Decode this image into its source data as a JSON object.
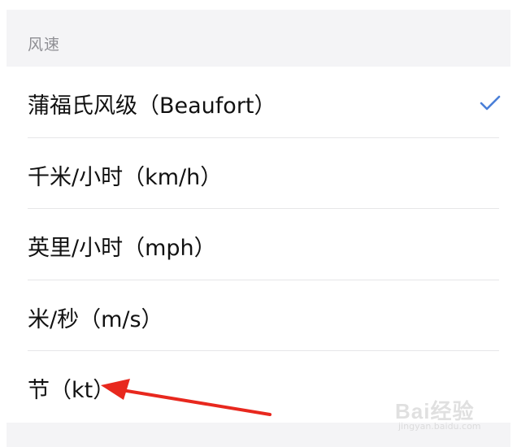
{
  "section": {
    "title": "风速"
  },
  "options": [
    {
      "label": "蒲福氏风级（Beaufort）",
      "selected": true
    },
    {
      "label": "千米/小时（km/h）",
      "selected": false
    },
    {
      "label": "英里/小时（mph）",
      "selected": false
    },
    {
      "label": "米/秒（m/s）",
      "selected": false
    },
    {
      "label": "节（kt）",
      "selected": false
    }
  ],
  "colors": {
    "check": "#4a7fd8",
    "arrow": "#e8281e",
    "header_bg": "#f4f4f6"
  },
  "icons": {
    "selected": "checkmark-icon"
  },
  "watermark": {
    "brand": "Bai经验",
    "url": "jingyan.baidu.com"
  }
}
